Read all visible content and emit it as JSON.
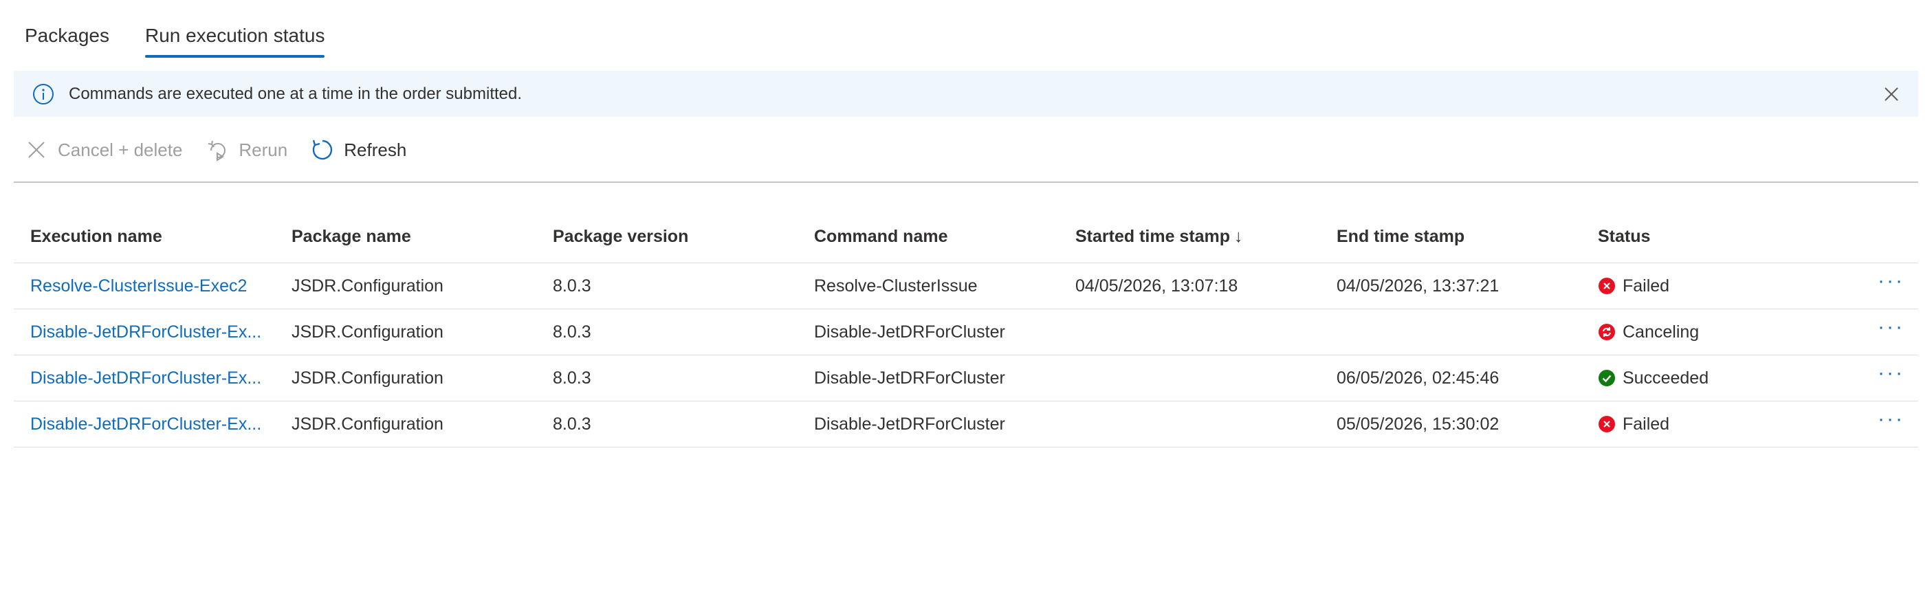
{
  "tabs": [
    {
      "label": "Packages",
      "active": false
    },
    {
      "label": "Run execution status",
      "active": true
    }
  ],
  "banner": {
    "message": "Commands are executed one at a time in the order submitted."
  },
  "toolbar": {
    "cancel_delete_label": "Cancel + delete",
    "rerun_label": "Rerun",
    "refresh_label": "Refresh"
  },
  "table": {
    "headers": {
      "execution_name": "Execution name",
      "package_name": "Package name",
      "package_version": "Package version",
      "command_name": "Command name",
      "started": "Started time stamp",
      "started_sort": "↓",
      "end": "End time stamp",
      "status": "Status"
    },
    "rows": [
      {
        "execution_name": "Resolve-ClusterIssue-Exec2",
        "package_name": "JSDR.Configuration",
        "package_version": "8.0.3",
        "command_name": "Resolve-ClusterIssue",
        "started": "04/05/2026, 13:07:18",
        "end": "04/05/2026, 13:37:21",
        "status": "Failed",
        "status_kind": "failed",
        "more": "···"
      },
      {
        "execution_name": "Disable-JetDRForCluster-Ex...",
        "package_name": "JSDR.Configuration",
        "package_version": "8.0.3",
        "command_name": "Disable-JetDRForCluster",
        "started": "",
        "end": "",
        "status": "Canceling",
        "status_kind": "canceling",
        "more": "···"
      },
      {
        "execution_name": "Disable-JetDRForCluster-Ex...",
        "package_name": "JSDR.Configuration",
        "package_version": "8.0.3",
        "command_name": "Disable-JetDRForCluster",
        "started": "",
        "end": "06/05/2026, 02:45:46",
        "status": "Succeeded",
        "status_kind": "succeeded",
        "more": "···"
      },
      {
        "execution_name": "Disable-JetDRForCluster-Ex...",
        "package_name": "JSDR.Configuration",
        "package_version": "8.0.3",
        "command_name": "Disable-JetDRForCluster",
        "started": "",
        "end": "05/05/2026, 15:30:02",
        "status": "Failed",
        "status_kind": "failed",
        "more": "···"
      }
    ]
  },
  "colors": {
    "accent": "#0f6cbd",
    "failed": "#e81123",
    "canceling": "#e81123",
    "succeeded": "#107c10",
    "disabled_text": "#a19f9d"
  },
  "icons": {
    "info": "info-icon",
    "close": "close-icon",
    "cancel": "x-icon",
    "rerun": "rerun-icon",
    "refresh": "refresh-icon",
    "failed": "error-circle-icon",
    "canceling": "sync-circle-icon",
    "succeeded": "checkmark-circle-icon",
    "more": "more-horizontal-icon"
  }
}
